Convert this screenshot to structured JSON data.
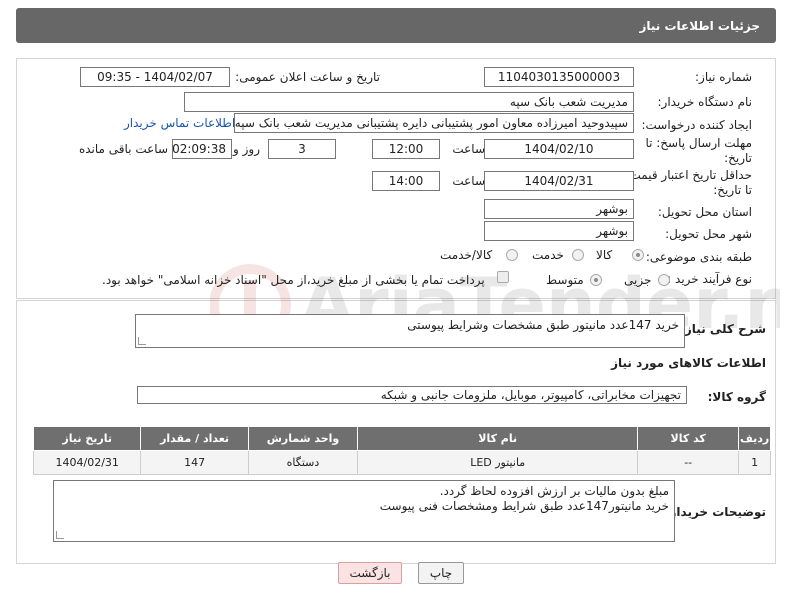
{
  "header": {
    "title": "جزئیات اطلاعات نیاز"
  },
  "labels": {
    "need_number": "شماره نیاز:",
    "announce_datetime": "تاریخ و ساعت اعلان عمومی:",
    "buyer_org": "نام دستگاه خریدار:",
    "requester": "ایجاد کننده درخواست:",
    "reply_deadline_1": "مهلت ارسال پاسخ: تا",
    "reply_deadline_2": "تاریخ:",
    "time": "ساعت",
    "day_and": "روز و",
    "remaining": "ساعت باقی مانده",
    "price_validity_1": "حداقل تاریخ اعتبار قیمت:",
    "price_validity_2": "تا تاریخ:",
    "delivery_province": "استان محل تحویل:",
    "delivery_city": "شهر محل تحویل:",
    "category": "طبقه بندی موضوعی:",
    "purchase_type": "نوع فرآیند خرید :",
    "need_desc": "شرح کلی نیاز:",
    "goods_info": "اطلاعات کالاهای مورد نیاز",
    "goods_group": "گروه کالا:",
    "buyer_notes": "توضیحات خریدار:"
  },
  "values": {
    "need_number": "1104030135000003",
    "announce_datetime": "1404/02/07 - 09:35",
    "buyer_org": "مدیریت شعب بانک سپه",
    "requester": "سپیدوحید امیرزاده معاون امور پشتیبانی دایره پشتیبانی مدیریت شعب بانک سپه",
    "contact_link": "اطلاعات تماس خریدار",
    "reply_date": "1404/02/10",
    "reply_time": "12:00",
    "days": "3",
    "remaining_time": "02:09:38",
    "validity_date": "1404/02/31",
    "validity_time": "14:00",
    "province": "بوشهر",
    "city": "بوشهر",
    "need_desc": "خرید 147عدد مانیتور طبق مشخصات وشرایط پیوستی",
    "goods_group": "تجهیزات مخابراتی، کامپیوتر، موبایل، ملزومات جانبی و شبکه",
    "buyer_notes": "مبلغ بدون مالیات بر ارزش افزوده لحاظ گردد.\nخرید مانیتور147عدد طبق شرایط  ومشخصات فنی پیوست"
  },
  "category_options": [
    {
      "label": "کالا",
      "selected": true
    },
    {
      "label": "خدمت",
      "selected": false
    },
    {
      "label": "کالا/خدمت",
      "selected": false
    }
  ],
  "purchase_options": [
    {
      "label": "جزیی",
      "selected": false
    },
    {
      "label": "متوسط",
      "selected": true
    }
  ],
  "payment_note": "پرداخت تمام یا بخشی از مبلغ خرید،از محل \"اسناد خزانه اسلامی\" خواهد بود.",
  "table": {
    "headers": [
      "ردیف",
      "کد کالا",
      "نام کالا",
      "واحد شمارش",
      "تعداد / مقدار",
      "تاریخ نیاز"
    ],
    "rows": [
      [
        "1",
        "--",
        "مانیتور LED",
        "دستگاه",
        "147",
        "1404/02/31"
      ]
    ]
  },
  "buttons": {
    "print": "چاپ",
    "back": "بازگشت"
  },
  "watermark": "AriaTender.neT"
}
